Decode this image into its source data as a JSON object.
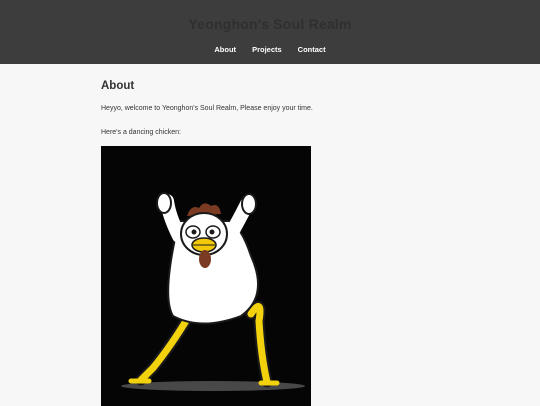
{
  "site": {
    "title": "Yeonghon's Soul Realm"
  },
  "nav": {
    "items": [
      "About",
      "Projects",
      "Contact"
    ]
  },
  "main": {
    "heading": "About",
    "intro": "Heyyo, welcome to Yeonghon's Soul Realm, Please enjoy your time.",
    "gif_caption": "Here's a dancing chicken:"
  },
  "image": {
    "subject": "dancing-chicken"
  },
  "colors": {
    "header_bg": "#3d3d3d",
    "page_bg": "#f7f7f7",
    "text": "#333333",
    "nav_text": "#ffffff",
    "gif_bg": "#050505",
    "beak": "#f2c90a",
    "legs": "#f2d20c",
    "comb": "#7a3b22"
  }
}
